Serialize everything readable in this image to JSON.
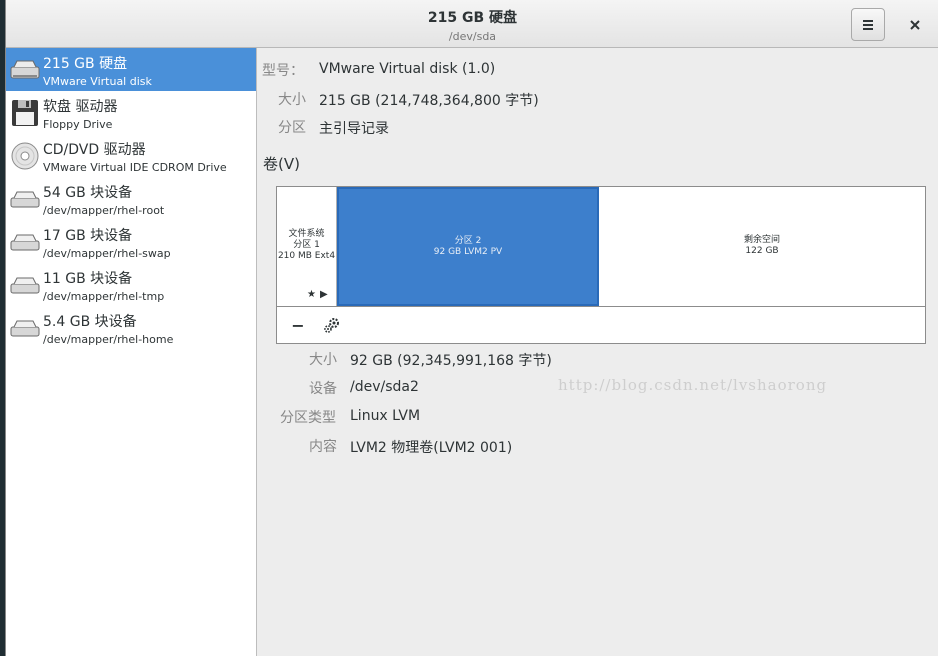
{
  "header": {
    "title": "215 GB 硬盘",
    "subtitle": "/dev/sda",
    "menu_icon": "hamburger-menu-icon",
    "close_label": "×"
  },
  "sidebar": {
    "items": [
      {
        "name": "215 GB 硬盘",
        "sub": "VMware Virtual disk",
        "icon": "hard-disk-icon",
        "selected": true
      },
      {
        "name": "软盘 驱动器",
        "sub": "Floppy Drive",
        "icon": "floppy-disk-icon"
      },
      {
        "name": "CD/DVD 驱动器",
        "sub": "VMware Virtual IDE CDROM Drive",
        "icon": "optical-disc-icon"
      },
      {
        "name": "54 GB 块设备",
        "sub": "/dev/mapper/rhel-root",
        "icon": "block-device-icon"
      },
      {
        "name": "17 GB 块设备",
        "sub": "/dev/mapper/rhel-swap",
        "icon": "block-device-icon"
      },
      {
        "name": "11 GB 块设备",
        "sub": "/dev/mapper/rhel-tmp",
        "icon": "block-device-icon"
      },
      {
        "name": "5.4 GB 块设备",
        "sub": "/dev/mapper/rhel-home",
        "icon": "block-device-icon"
      }
    ]
  },
  "disk_info": {
    "model_label": "型号：",
    "model_value": "VMware Virtual disk (1.0)",
    "size_label": "大小",
    "size_value": "215 GB (214,748,364,800 字节)",
    "partitioning_label": "分区",
    "partitioning_value": "主引导记录"
  },
  "volumes": {
    "heading": "卷(V)",
    "segments": [
      {
        "line1": "文件系统",
        "line2": "分区 1",
        "line3": "210 MB Ext4"
      },
      {
        "line1": "分区 2",
        "line2": "92 GB LVM2 PV"
      },
      {
        "line1": "剩余空间",
        "line2": "122 GB"
      }
    ],
    "toolbar": {
      "remove_label": "−",
      "settings_icon": "gears-icon"
    }
  },
  "partition_info": {
    "size_label": "大小",
    "size_value": "92 GB (92,345,991,168 字节)",
    "device_label": "设备",
    "device_value": "/dev/sda2",
    "type_label": "分区类型",
    "type_value": "Linux LVM",
    "contents_label": "内容",
    "contents_value": "LVM2 物理卷(LVM2 001)"
  },
  "watermark": "http://blog.csdn.net/lvshaorong",
  "colors": {
    "selection": "#4a90d9",
    "lvm_segment": "#3d7fcc"
  }
}
